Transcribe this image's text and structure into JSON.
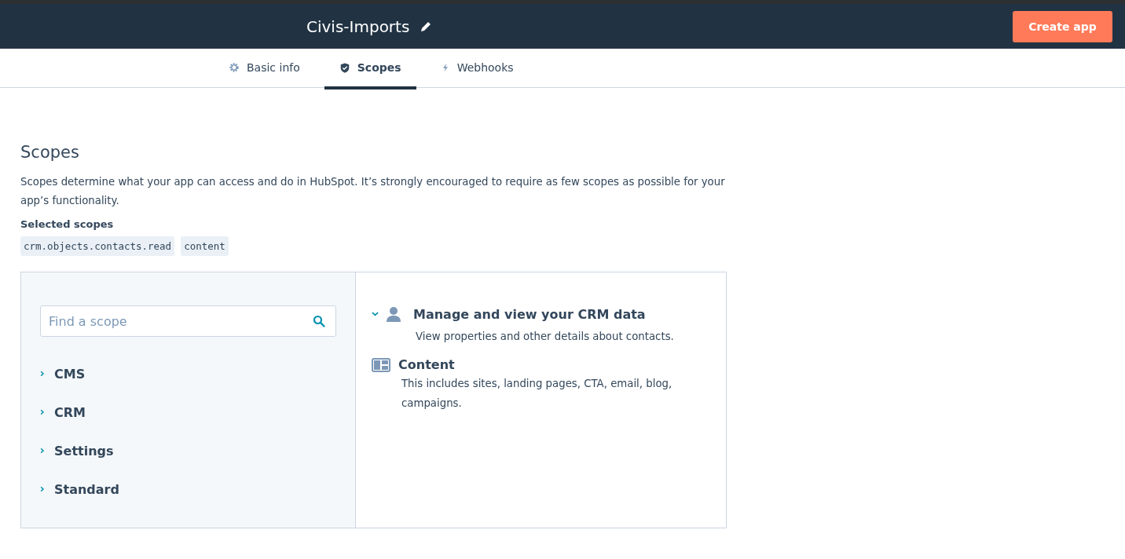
{
  "header": {
    "app_name": "Civis-Imports",
    "create_button": "Create app"
  },
  "tabs": [
    {
      "label": "Basic info",
      "kind": "gear",
      "selected": false
    },
    {
      "label": "Scopes",
      "kind": "shield",
      "selected": true
    },
    {
      "label": "Webhooks",
      "kind": "bolt",
      "selected": false
    }
  ],
  "section": {
    "title": "Scopes",
    "description": "Scopes determine what your app can access and do in HubSpot. It’s strongly encouraged to require as few scopes as possible for your app’s functionality.",
    "selected_label": "Selected scopes",
    "selected_scopes": [
      "crm.objects.contacts.read",
      "content"
    ]
  },
  "search": {
    "placeholder": "Find a scope"
  },
  "categories": [
    {
      "label": "CMS",
      "expanded": false
    },
    {
      "label": "CRM",
      "expanded": false
    },
    {
      "label": "Settings",
      "expanded": false
    },
    {
      "label": "Standard",
      "expanded": false
    }
  ],
  "scope_groups": [
    {
      "kind": "collapsible",
      "expanded": true,
      "title": "Manage and view your CRM data",
      "description": "View properties and other details about contacts."
    },
    {
      "kind": "plain",
      "title": "Content",
      "description": "This includes sites, landing pages, CTA, email, blog, campaigns."
    }
  ]
}
